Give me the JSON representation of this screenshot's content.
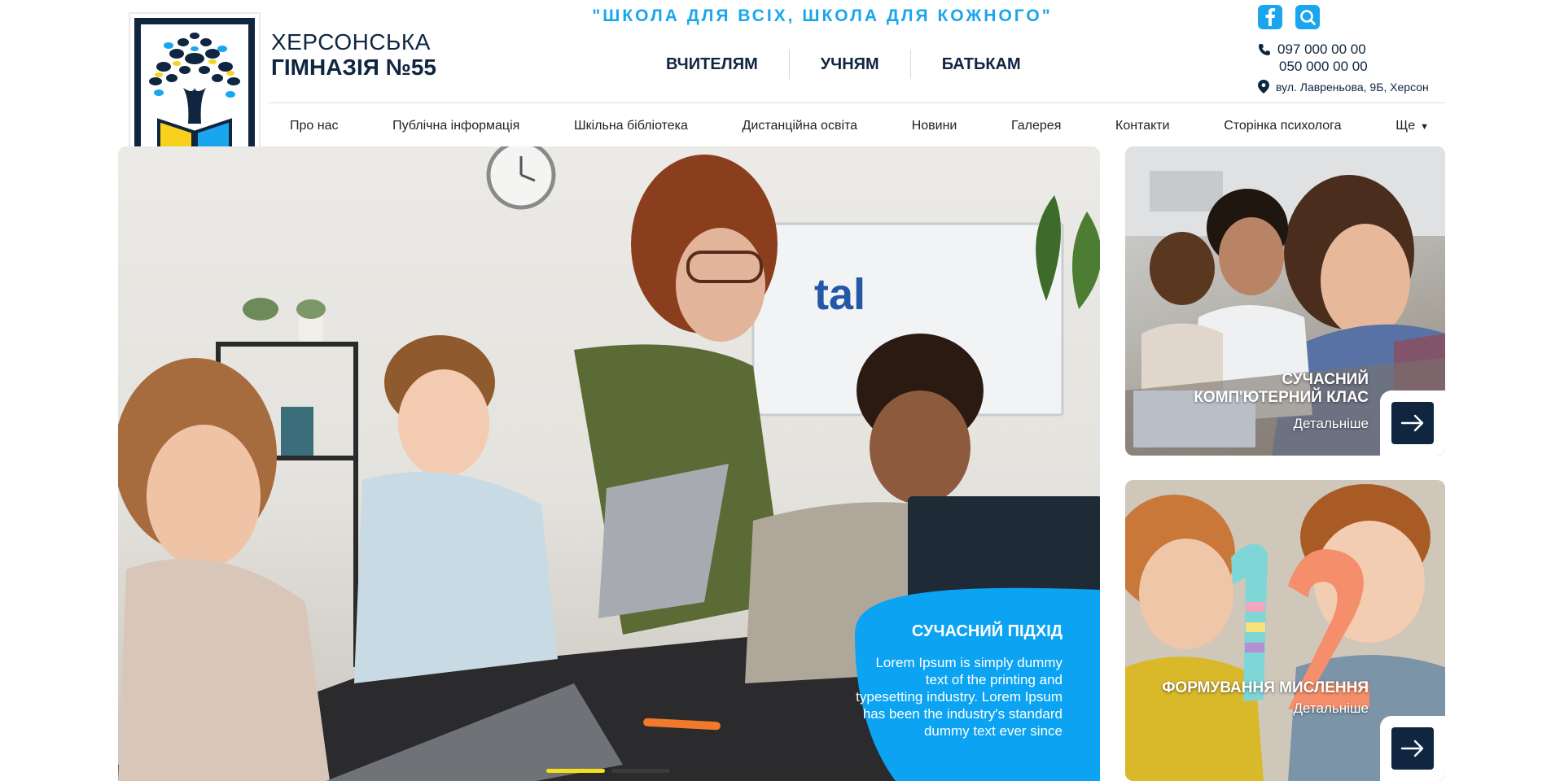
{
  "header": {
    "brand_line1": "ХЕРСОНСЬКА",
    "brand_line2": "ГІМНАЗІЯ №55",
    "slogan": "\"ШКОЛА ДЛЯ ВСІХ, ШКОЛА ДЛЯ КОЖНОГО\"",
    "roles": [
      "ВЧИТЕЛЯМ",
      "УЧНЯМ",
      "БАТЬКАМ"
    ],
    "social": [
      {
        "icon": "facebook-icon"
      },
      {
        "icon": "search-icon"
      }
    ],
    "contacts": {
      "phone1": "097 000 00 00",
      "phone2": "050 000 00 00",
      "address": "вул. Лавреньова, 9Б, Херсон"
    }
  },
  "menu": {
    "items": [
      "Про нас",
      "Публічна інформація",
      "Шкільна бібліотека",
      "Дистанційна освіта",
      "Новини",
      "Галерея",
      "Контакти",
      "Сторінка психолога",
      "Ще"
    ]
  },
  "hero": {
    "screen_text": "tal",
    "caption_title": "СУЧАСНИЙ ПІДХІД",
    "caption_text": "Lorem Ipsum is simply dummy text of the printing and typesetting industry. Lorem Ipsum has been the industry's standard dummy text ever since",
    "slides_total": 2,
    "active_slide": 1
  },
  "cards": [
    {
      "title": "СУЧАСНИЙ КОМП'ЮТЕРНИЙ КЛАС",
      "more": "Детальніше"
    },
    {
      "title": "ФОРМУВАННЯ МИСЛЕННЯ",
      "more": "Детальніше"
    }
  ],
  "colors": {
    "navy": "#0f2540",
    "accent_blue": "#1aa6ee",
    "hero_blue": "#0ba3f2",
    "yellow": "#f7e017"
  }
}
